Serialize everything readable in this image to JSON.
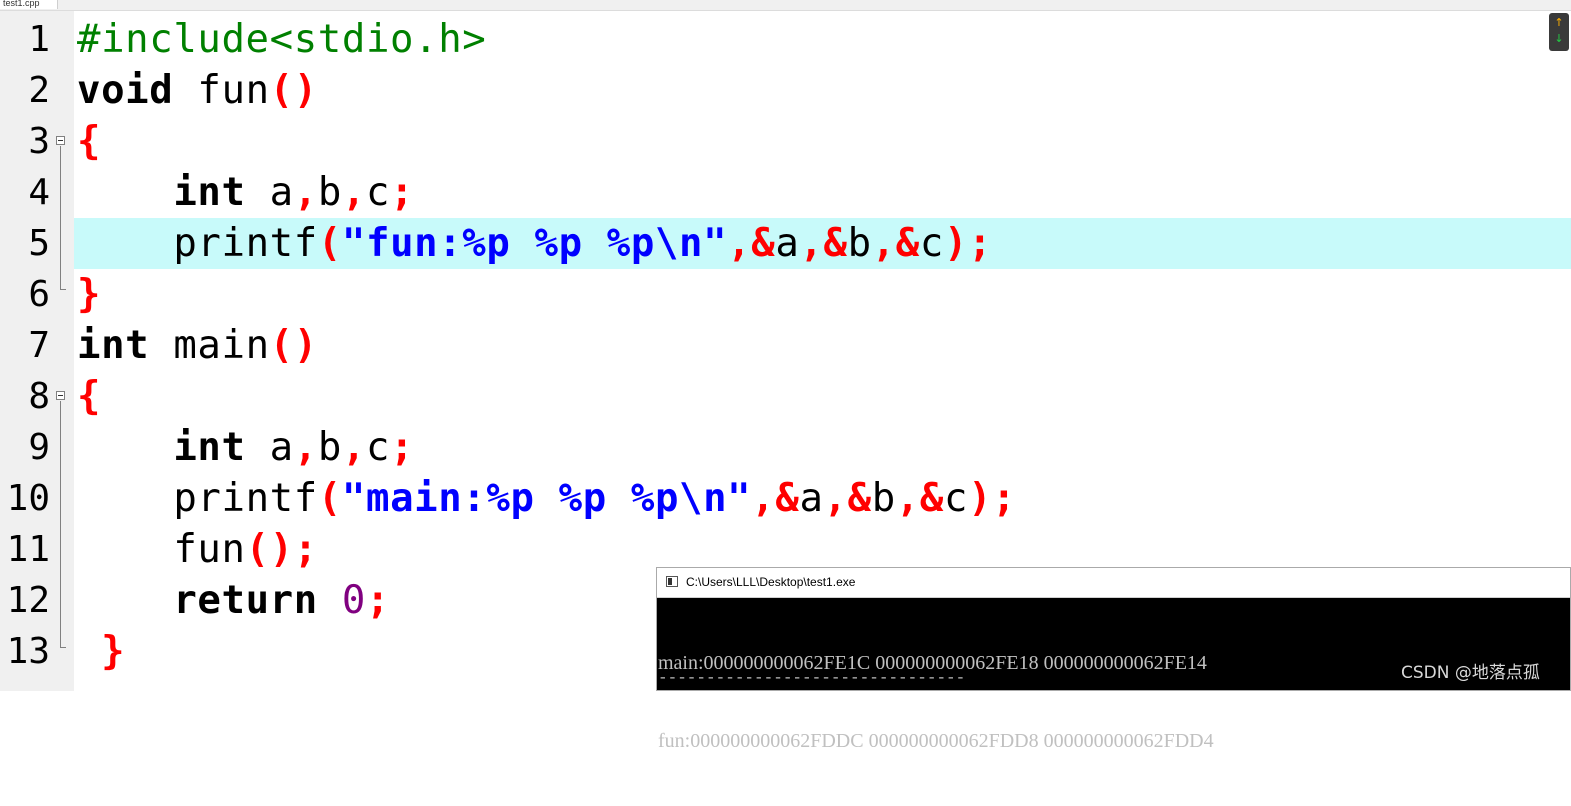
{
  "editor": {
    "tab_label": "test1.cpp",
    "current_line": 5,
    "lines": [
      {
        "num": "1"
      },
      {
        "num": "2"
      },
      {
        "num": "3"
      },
      {
        "num": "4"
      },
      {
        "num": "5"
      },
      {
        "num": "6"
      },
      {
        "num": "7"
      },
      {
        "num": "8"
      },
      {
        "num": "9"
      },
      {
        "num": "10"
      },
      {
        "num": "11"
      },
      {
        "num": "12"
      },
      {
        "num": "13"
      }
    ],
    "tokens": {
      "l1_pre": "#include<stdio.h>",
      "l2_kw": "void",
      "l2_name": " fun",
      "l2_paren": "()",
      "l3_brace": "{",
      "l4_indent": "    ",
      "l4_kw": "int",
      "l4_a": " a",
      "l4_c1": ",",
      "l4_b": "b",
      "l4_c2": ",",
      "l4_c": "c",
      "l4_semi": ";",
      "l5_indent": "    ",
      "l5_fn": "printf",
      "l5_open": "(",
      "l5_str": "\"fun:%p %p %p\\n\"",
      "l5_args1": ",&",
      "l5_a": "a",
      "l5_args2": ",&",
      "l5_b": "b",
      "l5_args3": ",&",
      "l5_c": "c",
      "l5_close": ");",
      "l6_brace": "}",
      "l7_kw": "int",
      "l7_name": " main",
      "l7_paren": "()",
      "l8_brace": "{",
      "l9_indent": "    ",
      "l9_kw": "int",
      "l9_a": " a",
      "l9_c1": ",",
      "l9_b": "b",
      "l9_c2": ",",
      "l9_c": "c",
      "l9_semi": ";",
      "l10_indent": "    ",
      "l10_fn": "printf",
      "l10_open": "(",
      "l10_str": "\"main:%p %p %p\\n\"",
      "l10_args1": ",&",
      "l10_a": "a",
      "l10_args2": ",&",
      "l10_b": "b",
      "l10_args3": ",&",
      "l10_c": "c",
      "l10_close": ");",
      "l11_indent": "    ",
      "l11_fn": "fun",
      "l11_call": "();",
      "l12_indent": "    ",
      "l12_kw": "return",
      "l12_sp": " ",
      "l12_num": "0",
      "l12_semi": ";",
      "l13_sp": " ",
      "l13_brace": "}"
    },
    "nav": {
      "up_icon": "↑",
      "down_icon": "↓"
    }
  },
  "console": {
    "title": "C:\\Users\\LLL\\Desktop\\test1.exe",
    "output": [
      "main:000000000062FE1C 000000000062FE18 000000000062FE14",
      "fun:000000000062FDDC 000000000062FDD8 000000000062FDD4"
    ],
    "separator": "--------------------------------"
  },
  "watermark": "CSDN @地落点孤",
  "colors": {
    "keyword": "#000000",
    "preprocessor": "#008000",
    "operator": "#ff0000",
    "string": "#0000ff",
    "number": "#800080",
    "current_line_bg": "#c8fafa",
    "gutter_bg": "#f0f0f0"
  }
}
